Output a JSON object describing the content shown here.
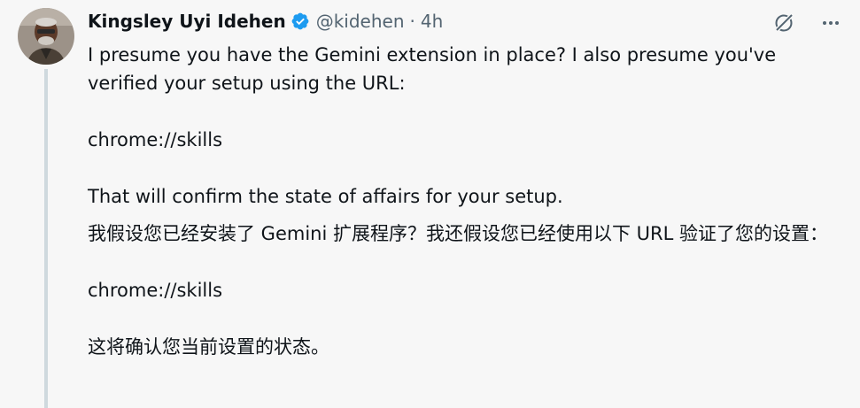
{
  "post": {
    "author_name": "Kingsley Uyi Idehen",
    "handle": "@kidehen",
    "separator": "·",
    "time": "4h",
    "verified_icon": "verified-badge-icon",
    "accent_color": "#1d9bf0",
    "actions": [
      "grok-icon",
      "more-options-icon"
    ],
    "text": {
      "p1": "I presume you have the Gemini extension in place? I also presume you've verified your setup using the URL:",
      "p2": "chrome://skills",
      "p3": "That will confirm the state of affairs for your setup.",
      "zh1": "我假设您已经安装了 Gemini 扩展程序？我还假设您已经使用以下 URL 验证了您的设置：",
      "zh2": "chrome://skills",
      "zh3": "这将确认您当前设置的状态。"
    }
  }
}
